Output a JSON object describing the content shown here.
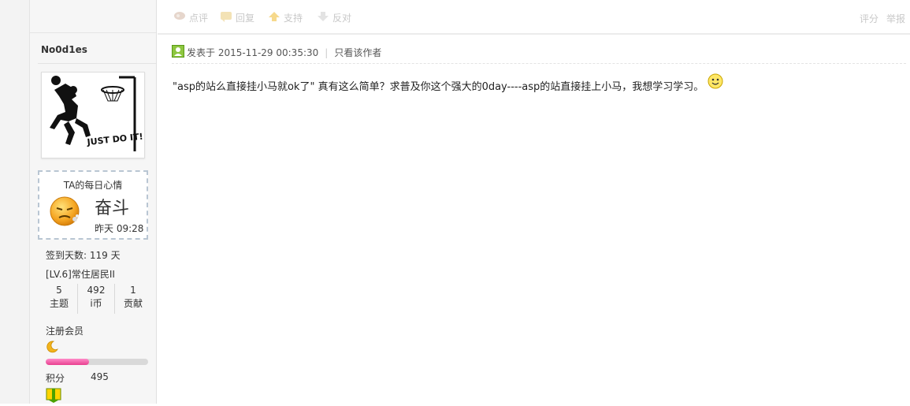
{
  "toolbar": {
    "comment_label": "点评",
    "reply_label": "回复",
    "support_label": "支持",
    "oppose_label": "反对",
    "rate_label": "评分",
    "report_label": "举报"
  },
  "author": {
    "name": "No0d1es",
    "avatar_caption": "JUST DO IT!",
    "mood_title": "TA的每日心情",
    "mood_word": "奋斗",
    "mood_time": "昨天 09:28",
    "signin": "签到天数: 119 天",
    "level": "[LV.6]常住居民II",
    "stats": [
      {
        "num": "5",
        "label": "主题"
      },
      {
        "num": "492",
        "label": "i币"
      },
      {
        "num": "1",
        "label": "贡献"
      }
    ],
    "member_group": "注册会员",
    "progress_fraction": 0.42,
    "points_label": "积分",
    "points_value": "495"
  },
  "post": {
    "posted_at": "发表于 2015-11-29 00:35:30",
    "only_author": "只看该作者",
    "body": "\"asp的站么直接挂小马就ok了\" 真有这么简单？求普及你这个强大的0day----asp的站直接挂上小马，我想学习学习。"
  },
  "colors": {
    "progress_fill": "#e8408f",
    "mood_border": "#b9c6d3",
    "sidebar_bg": "#f6f6f6"
  },
  "icons": {
    "comment": "comment-icon",
    "reply": "reply-icon",
    "support": "thumbs-up-arrow-icon",
    "oppose": "thumbs-down-arrow-icon",
    "online": "user-online-icon",
    "emoticon": "smiley-icon",
    "moon": "crescent-moon-icon",
    "medal": "medal-icon"
  }
}
